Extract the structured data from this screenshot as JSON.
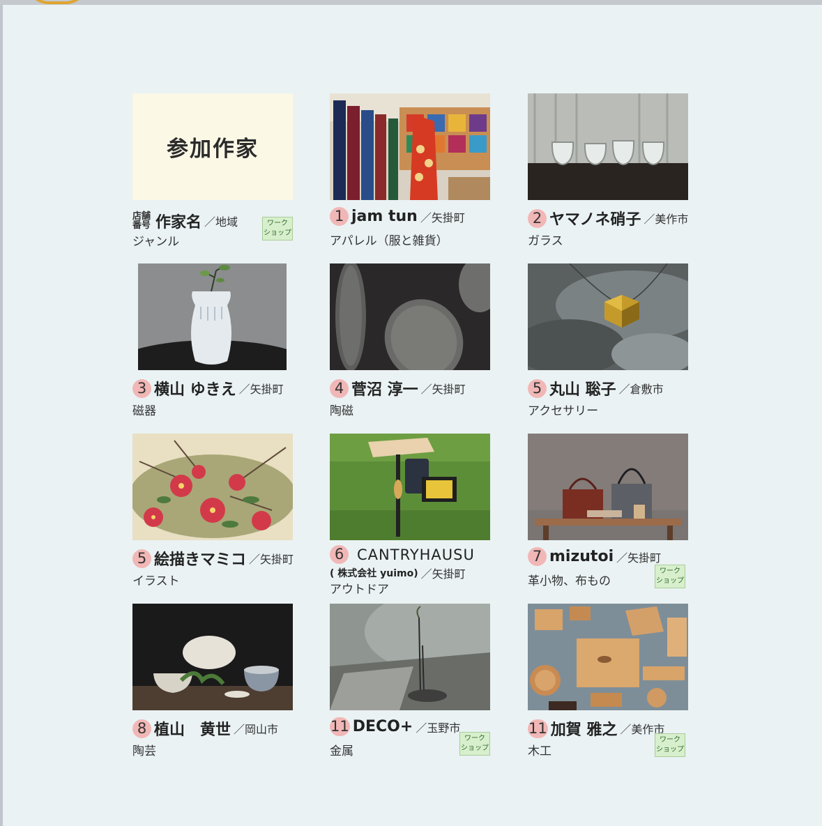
{
  "title": "参加作家",
  "legend": {
    "store_label_1": "店舗",
    "store_label_2": "番号",
    "name": "作家名",
    "region": "／地域",
    "genre": "ジャンル",
    "ws_1": "ワーク",
    "ws_2": "ショップ"
  },
  "artists": [
    {
      "number": "1",
      "name": "jam tun",
      "region": "／矢掛町",
      "genre": "アパレル（服と雑貨）",
      "workshop": false,
      "image": "textile-icon"
    },
    {
      "number": "2",
      "name": "ヤマノネ硝子",
      "region": "／美作市",
      "genre": "ガラス",
      "workshop": false,
      "image": "glass-cups-icon"
    },
    {
      "number": "3",
      "name": "横山 ゆきえ",
      "region": "／矢掛町",
      "genre": "磁器",
      "workshop": false,
      "image": "vase-icon"
    },
    {
      "number": "4",
      "name": "菅沼 淳一",
      "region": "／矢掛町",
      "genre": "陶磁",
      "workshop": false,
      "image": "oval-plates-icon"
    },
    {
      "number": "5",
      "name": "丸山 聡子",
      "region": "／倉敷市",
      "genre": "アクセサリー",
      "workshop": false,
      "image": "pendant-icon"
    },
    {
      "number": "5",
      "name": "絵描きマミコ",
      "region": "／矢掛町",
      "genre": "イラスト",
      "workshop": false,
      "image": "camellia-painting-icon"
    },
    {
      "number": "6",
      "name": "CANTRYHAUSU",
      "name2": "( 株式会社 yuimo)",
      "region": "／矢掛町",
      "genre": "アウトドア",
      "workshop": false,
      "image": "outdoor-table-icon"
    },
    {
      "number": "7",
      "name": "mizutoi",
      "region": "／矢掛町",
      "genre": "革小物、布もの",
      "workshop": true,
      "image": "leather-bags-icon"
    },
    {
      "number": "8",
      "name": "植山　黄世",
      "region": "／岡山市",
      "genre": "陶芸",
      "workshop": false,
      "image": "pottery-icon"
    },
    {
      "number": "11",
      "name": "DECO+",
      "region": "／玉野市",
      "genre": "金属",
      "workshop": true,
      "image": "metal-stand-icon"
    },
    {
      "number": "11",
      "name": "加賀 雅之",
      "region": "／美作市",
      "genre": "木工",
      "workshop": true,
      "image": "wood-crafts-icon"
    }
  ],
  "colors": {
    "background": "#eaf2f4",
    "number_badge": "#f1b7b6",
    "workshop_badge": "#d8efcd",
    "header_box": "#fbf8e6"
  }
}
